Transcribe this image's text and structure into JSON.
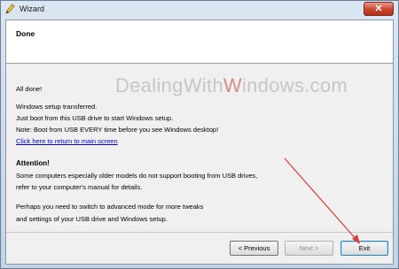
{
  "window": {
    "title": "Wizard"
  },
  "header": {
    "title": "Done"
  },
  "watermark": {
    "pre": "DealingWith",
    "highlight": "W",
    "post": "indows.com"
  },
  "body": {
    "line1": "All done!",
    "line2": "Windows setup transferred.",
    "line3": "Just boot from this USB drive to start Windows setup.",
    "line4": "Note: Boot from USB EVERY time before you see Windows desktop!",
    "link": "Click here to return to main screen",
    "attention": "Attention!",
    "line5": "Some computers especially older models do not support booting from USB drives,",
    "line6": "refer to your computer's manual for details.",
    "line7": "Perhaps you need to switch to advanced mode for more tweaks",
    "line8": "and settings of your USB drive and Windows setup."
  },
  "buttons": {
    "previous": "< Previous",
    "next": "Next >",
    "exit": "Exit"
  },
  "colors": {
    "arrow": "#e03a3a",
    "link": "#0000cc"
  }
}
